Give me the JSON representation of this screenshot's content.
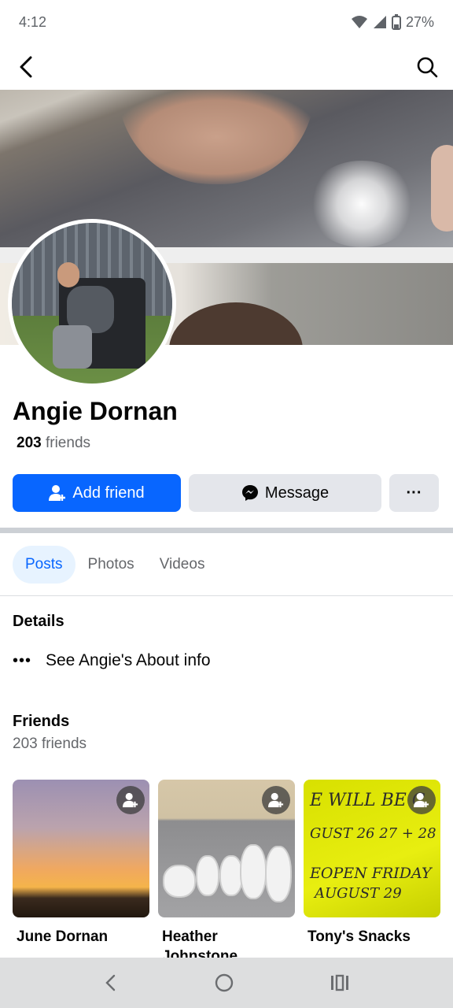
{
  "status": {
    "time": "4:12",
    "battery": "27%"
  },
  "nav": {
    "back_icon": "back-arrow-icon",
    "search_icon": "search-icon"
  },
  "profile": {
    "name": "Angie Dornan",
    "friends_count": "203",
    "friends_word": "friends"
  },
  "actions": {
    "add_friend": "Add friend",
    "message": "Message",
    "more": "···"
  },
  "tabs": [
    {
      "label": "Posts",
      "active": true
    },
    {
      "label": "Photos"
    },
    {
      "label": "Videos"
    }
  ],
  "details": {
    "title": "Details",
    "about": "See Angie's About info"
  },
  "friends_section": {
    "title": "Friends",
    "subtitle": "203 friends"
  },
  "friends": [
    {
      "name": "June Dornan"
    },
    {
      "name": "Heather Johnstone"
    },
    {
      "name": "Tony's Snacks"
    }
  ],
  "colors": {
    "primary": "#0866ff",
    "secondary_bg": "#e4e6eb",
    "text_muted": "#65676b"
  }
}
